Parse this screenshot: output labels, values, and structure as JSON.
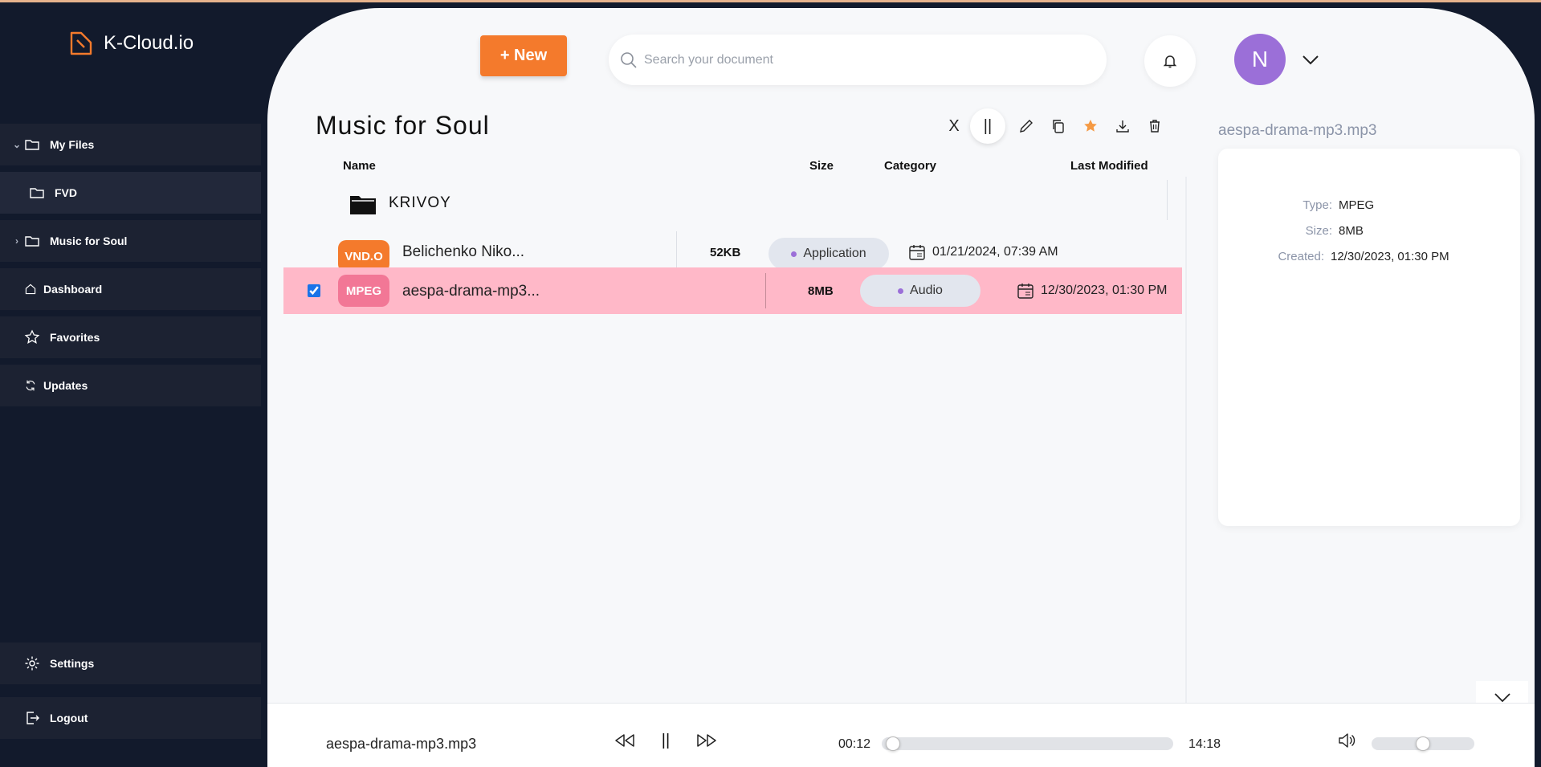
{
  "app": {
    "name": "K-Cloud.io"
  },
  "sidebar": {
    "items": [
      {
        "label": "My Files"
      },
      {
        "label": "FVD"
      },
      {
        "label": "Music for Soul"
      },
      {
        "label": "Dashboard"
      },
      {
        "label": "Favorites"
      },
      {
        "label": "Updates"
      }
    ],
    "settings_label": "Settings",
    "logout_label": "Logout"
  },
  "header": {
    "new_label": "+ New",
    "search_placeholder": "Search your document",
    "avatar_initial": "N"
  },
  "folder": {
    "title": "Music for Soul",
    "toolbar": {
      "close_label": "X",
      "pause_label": "||"
    }
  },
  "table": {
    "columns": [
      "Name",
      "Size",
      "Category",
      "Last Modified"
    ],
    "subfolder": "KRIVOY",
    "rows": [
      {
        "badge": "VND.O",
        "badge_color": "#f47a2c",
        "name": "Belichenko Niko...",
        "size": "52KB",
        "category": "Application",
        "modified": "01/21/2024, 07:39 AM",
        "selected": false
      },
      {
        "badge": "MPEG",
        "badge_color": "#f27796",
        "name": "aespa-drama-mp3...",
        "size": "8MB",
        "category": "Audio",
        "modified": "12/30/2023, 01:30 PM",
        "selected": true
      }
    ]
  },
  "details": {
    "file_name": "aespa-drama-mp3.mp3",
    "type_label": "Type:",
    "type_value": "MPEG",
    "size_label": "Size:",
    "size_value": "8MB",
    "created_label": "Created:",
    "created_value": "12/30/2023, 01:30 PM"
  },
  "player": {
    "track_name": "aespa-drama-mp3.mp3",
    "elapsed": "00:12",
    "duration": "14:18",
    "progress_fraction": 0.014,
    "volume_fraction": 0.5
  },
  "colors": {
    "accent": "#f47a2c",
    "sidebar_bg": "#121a2c",
    "selected_row": "#ffb8c8",
    "avatar": "#9b6fd8"
  }
}
